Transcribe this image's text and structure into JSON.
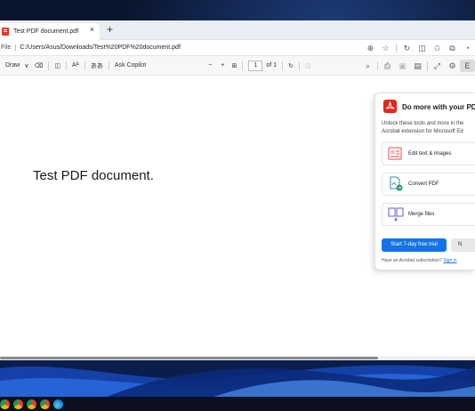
{
  "tab": {
    "title": "Test PDF document.pdf",
    "close": "×",
    "new_tab": "+"
  },
  "address": {
    "prefix": "File",
    "separator": "|",
    "url": "C:/Users/Asus/Downloads/Test%20PDF%20document.pdf"
  },
  "pdf_toolbar": {
    "draw_label": "Draw",
    "read_aloud_label": "Aᴬ",
    "translate_label": "ああ",
    "ask_copilot_label": "Ask Copilot",
    "zoom_out": "−",
    "zoom_in": "+",
    "page_number": "1",
    "page_total": "of 1",
    "acrobat_chip": "E"
  },
  "document": {
    "text": "Test PDF document."
  },
  "acrobat_flyout": {
    "title": "Do more with your PDF",
    "description_line1": "Unlock these tools and more in the",
    "description_line2": "Acrobat extension for Microsoft Ed",
    "tools": [
      {
        "label": "Edit text & images",
        "icon": "edit-text-images-icon"
      },
      {
        "label": "Convert PDF",
        "icon": "convert-pdf-icon"
      },
      {
        "label": "Merge files",
        "icon": "merge-files-icon"
      }
    ],
    "trial_button": "Start 7-day free trial",
    "no_button": "N",
    "footer_text": "Have an Acrobat subscription?",
    "footer_link": "Sign in"
  },
  "colors": {
    "acrobat_red": "#e0281c",
    "primary_button": "#1473e6",
    "wallpaper_dark": "#0a1a3a"
  },
  "taskbar": {
    "apps": [
      "chrome-icon",
      "chrome-icon",
      "chrome-icon",
      "chrome-icon",
      "edge-icon"
    ]
  }
}
